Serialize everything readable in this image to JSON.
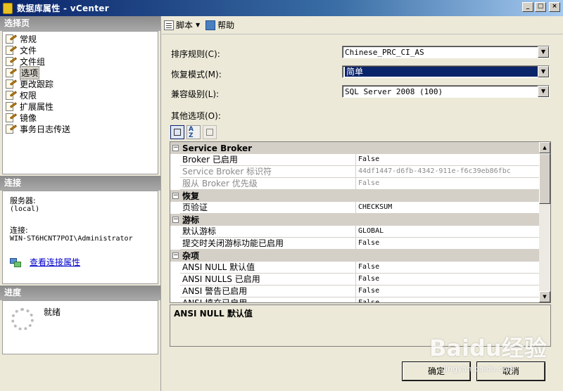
{
  "window": {
    "title": "数据库属性 - vCenter",
    "buttons": [
      "_",
      "□",
      "×"
    ]
  },
  "left": {
    "pages_header": "选择页",
    "pages": [
      "常规",
      "文件",
      "文件组",
      "选项",
      "更改跟踪",
      "权限",
      "扩展属性",
      "镜像",
      "事务日志传送"
    ],
    "selected_page": "选项",
    "connection_header": "连接",
    "server_label": "服务器:",
    "server_value": "(local)",
    "connection_label": "连接:",
    "connection_value": "WIN-ST6HCNT7POI\\Administrator",
    "view_link": "查看连接属性",
    "progress_header": "进度",
    "progress_status": "就绪"
  },
  "toolbar": {
    "script_label": "脚本",
    "help_label": "帮助"
  },
  "form": {
    "collation_label": "排序规则(C):",
    "collation_value": "Chinese_PRC_CI_AS",
    "recovery_label": "恢复模式(M):",
    "recovery_value": "简单",
    "compat_label": "兼容级别(L):",
    "compat_value": "SQL Server 2008 (100)",
    "other_label": "其他选项(O):"
  },
  "grid": {
    "categories": [
      {
        "name": "Service Broker",
        "rows": [
          {
            "name": "Broker 已启用",
            "value": "False",
            "dim": false
          },
          {
            "name": "Service Broker 标识符",
            "value": "44df1447-d6fb-4342-911e-f6c39eb86fbc",
            "dim": true
          },
          {
            "name": "服从 Broker 优先级",
            "value": "False",
            "dim": true
          }
        ]
      },
      {
        "name": "恢复",
        "rows": [
          {
            "name": "页验证",
            "value": "CHECKSUM",
            "dim": false
          }
        ]
      },
      {
        "name": "游标",
        "rows": [
          {
            "name": "默认游标",
            "value": "GLOBAL",
            "dim": false
          },
          {
            "name": "提交时关闭游标功能已启用",
            "value": "False",
            "dim": false
          }
        ]
      },
      {
        "name": "杂项",
        "rows": [
          {
            "name": "ANSI NULL 默认值",
            "value": "False",
            "dim": false
          },
          {
            "name": "ANSI NULLS 已启用",
            "value": "False",
            "dim": false
          },
          {
            "name": "ANSI 警告已启用",
            "value": "False",
            "dim": false
          },
          {
            "name": "ANSI 填充已启用",
            "value": "False",
            "dim": false
          }
        ]
      }
    ],
    "description": "ANSI NULL 默认值"
  },
  "buttons": {
    "ok": "确定",
    "cancel": "取消"
  },
  "watermark": {
    "brand": "Baidu经验",
    "url": "jingyan.baidu.com"
  },
  "colors": {
    "title_start": "#0a246a",
    "title_end": "#a6caf0",
    "selection": "#0a246a",
    "section_header": "#8b8b8b"
  }
}
